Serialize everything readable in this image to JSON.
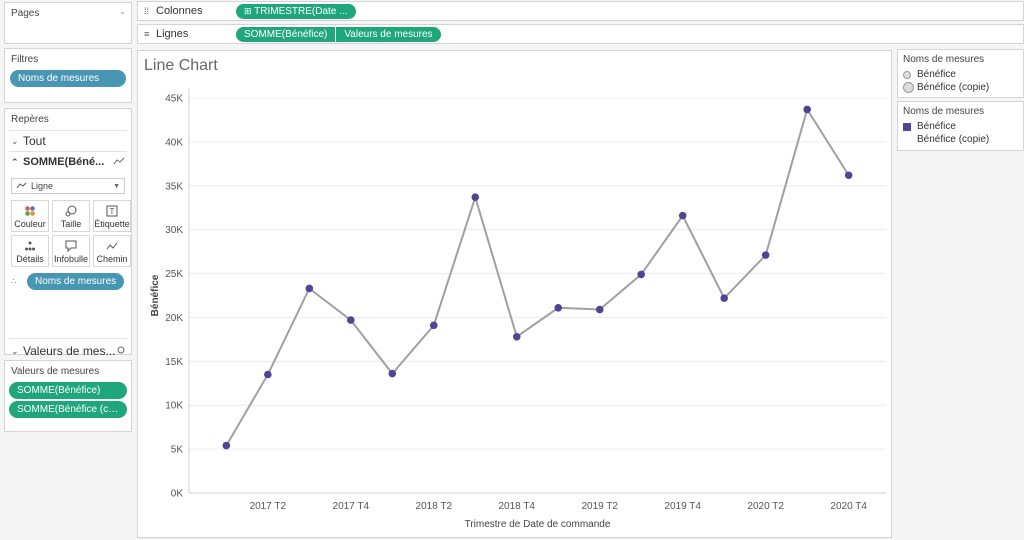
{
  "pages": {
    "title": "Pages"
  },
  "filters": {
    "title": "Filtres",
    "pill": "Noms de mesures"
  },
  "marks": {
    "title": "Repères",
    "all_label": "Tout",
    "measure_label": "SOMME(Béné...",
    "mark_type": "Ligne",
    "buttons": [
      {
        "label": "Couleur",
        "icon": "color-icon"
      },
      {
        "label": "Taille",
        "icon": "size-icon"
      },
      {
        "label": "Étiquette",
        "icon": "label-icon"
      },
      {
        "label": "Détails",
        "icon": "detail-icon"
      },
      {
        "label": "Infobulle",
        "icon": "tooltip-icon"
      },
      {
        "label": "Chemin",
        "icon": "path-icon"
      }
    ],
    "pill": "Noms de mesures",
    "values_label": "Valeurs de mes..."
  },
  "measure_values": {
    "title": "Valeurs de mesures",
    "pills": [
      "SOMME(Bénéfice)",
      "SOMME(Bénéfice (cop..."
    ]
  },
  "shelves": {
    "columns_label": "Colonnes",
    "columns_pill": "TRIMESTRE(Date ...",
    "rows_label": "Lignes",
    "rows_pills": [
      "SOMME(Bénéfice)",
      "Valeurs de mesures"
    ]
  },
  "legend_size": {
    "title": "Noms de mesures",
    "items": [
      "Bénéfice",
      "Bénéfice (copie)"
    ]
  },
  "legend_color": {
    "title": "Noms de mesures",
    "items": [
      "Bénéfice",
      "Bénéfice (copie)"
    ]
  },
  "colors": {
    "line": "#a0a0a0",
    "point": "#4e4597",
    "pill_green": "#1fa67a",
    "pill_blue": "#4996b2"
  },
  "chart_data": {
    "type": "line",
    "title": "Line Chart",
    "xlabel": "Trimestre de Date de commande",
    "ylabel": "Bénéfice",
    "x": [
      "2017 T1",
      "2017 T2",
      "2017 T3",
      "2017 T4",
      "2018 T1",
      "2018 T2",
      "2018 T3",
      "2018 T4",
      "2019 T1",
      "2019 T2",
      "2019 T3",
      "2019 T4",
      "2020 T1",
      "2020 T2",
      "2020 T3",
      "2020 T4"
    ],
    "x_tick_labels": [
      "2017 T2",
      "2017 T4",
      "2018 T2",
      "2018 T4",
      "2019 T2",
      "2019 T4",
      "2020 T2",
      "2020 T4"
    ],
    "values": [
      5400,
      13500,
      23300,
      19700,
      13600,
      19100,
      33700,
      17800,
      21100,
      20900,
      24900,
      31600,
      22200,
      27100,
      43700,
      36200
    ],
    "ylim": [
      0,
      45000
    ],
    "y_ticks": [
      "0K",
      "5K",
      "10K",
      "15K",
      "20K",
      "25K",
      "30K",
      "35K",
      "40K",
      "45K"
    ],
    "grid": true
  }
}
